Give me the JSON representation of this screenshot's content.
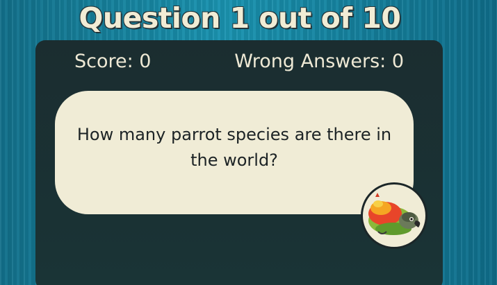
{
  "header": {
    "title": "Question 1 out of 10"
  },
  "stats": {
    "score": "Score: 0",
    "wrong_answers": "Wrong Answers: 0"
  },
  "question": {
    "text": "How many parrot species are there in the world?"
  },
  "mascot": {
    "icon": "parrot-icon"
  },
  "colors": {
    "background": "#1a93b0",
    "panel": "#1b2d30",
    "card": "#f0ecd6",
    "title_text": "#f1ecd5"
  }
}
